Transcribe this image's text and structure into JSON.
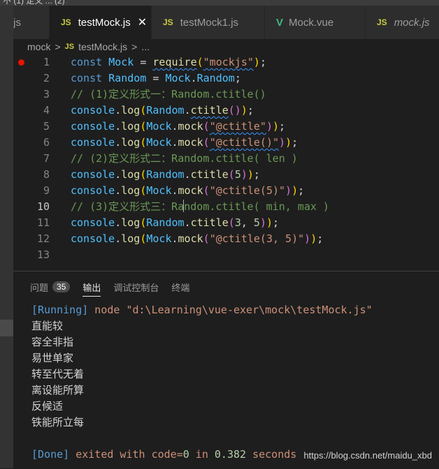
{
  "topstrip": "不 (1)  定义 ...  (2)",
  "tabs": [
    {
      "icon": "JS",
      "label": ".js",
      "active": false
    },
    {
      "icon": "JS",
      "label": "testMock.js",
      "active": true
    },
    {
      "icon": "JS",
      "label": "testMock1.js",
      "active": false
    },
    {
      "icon": "V",
      "label": "Mock.vue",
      "active": false
    },
    {
      "icon": "JS",
      "label": "mock.js",
      "active": false
    }
  ],
  "tab_close": "✕",
  "breadcrumb": {
    "folder": "mock",
    "sep": ">",
    "icon": "JS",
    "file": "testMock.js",
    "rest": "..."
  },
  "lines": [
    {
      "n": "1",
      "t": [
        [
          "kw",
          "const "
        ],
        [
          "cls",
          "Mock"
        ],
        [
          "pl",
          " = "
        ],
        [
          "fn",
          "require"
        ],
        [
          "p1",
          "("
        ],
        [
          "str",
          "\"mockjs\""
        ],
        [
          "p1",
          ")"
        ],
        [
          "pl",
          ";"
        ]
      ]
    },
    {
      "n": "2",
      "t": [
        [
          "kw",
          "const "
        ],
        [
          "cls",
          "Random"
        ],
        [
          "pl",
          " = "
        ],
        [
          "cls",
          "Mock"
        ],
        [
          "pl",
          "."
        ],
        [
          "cls",
          "Random"
        ],
        [
          "pl",
          ";"
        ]
      ]
    },
    {
      "n": "3",
      "t": [
        [
          "cmt",
          "// (1)定义形式一：Random.ctitle()"
        ]
      ]
    },
    {
      "n": "4",
      "t": [
        [
          "cls",
          "console"
        ],
        [
          "pl",
          "."
        ],
        [
          "fn",
          "log"
        ],
        [
          "p1",
          "("
        ],
        [
          "cls",
          "Random"
        ],
        [
          "pl",
          "."
        ],
        [
          "fn",
          "ctitle"
        ],
        [
          "p2",
          "()"
        ],
        [
          "p1",
          ")"
        ],
        [
          "pl",
          ";"
        ]
      ]
    },
    {
      "n": "5",
      "t": [
        [
          "cls",
          "console"
        ],
        [
          "pl",
          "."
        ],
        [
          "fn",
          "log"
        ],
        [
          "p1",
          "("
        ],
        [
          "cls",
          "Mock"
        ],
        [
          "pl",
          "."
        ],
        [
          "fn",
          "mock"
        ],
        [
          "p2",
          "("
        ],
        [
          "str",
          "\"@ctitle\""
        ],
        [
          "p2",
          ")"
        ],
        [
          "p1",
          ")"
        ],
        [
          "pl",
          ";"
        ]
      ]
    },
    {
      "n": "6",
      "t": [
        [
          "cls",
          "console"
        ],
        [
          "pl",
          "."
        ],
        [
          "fn",
          "log"
        ],
        [
          "p1",
          "("
        ],
        [
          "cls",
          "Mock"
        ],
        [
          "pl",
          "."
        ],
        [
          "fn",
          "mock"
        ],
        [
          "p2",
          "("
        ],
        [
          "str",
          "\"@ctitle()\""
        ],
        [
          "p2",
          ")"
        ],
        [
          "p1",
          ")"
        ],
        [
          "pl",
          ";"
        ]
      ]
    },
    {
      "n": "7",
      "t": [
        [
          "cmt",
          "// (2)定义形式二：Random.ctitle( len )"
        ]
      ]
    },
    {
      "n": "8",
      "t": [
        [
          "cls",
          "console"
        ],
        [
          "pl",
          "."
        ],
        [
          "fn",
          "log"
        ],
        [
          "p1",
          "("
        ],
        [
          "cls",
          "Random"
        ],
        [
          "pl",
          "."
        ],
        [
          "fn",
          "ctitle"
        ],
        [
          "p2",
          "("
        ],
        [
          "num",
          "5"
        ],
        [
          "p2",
          ")"
        ],
        [
          "p1",
          ")"
        ],
        [
          "pl",
          ";"
        ]
      ]
    },
    {
      "n": "9",
      "t": [
        [
          "cls",
          "console"
        ],
        [
          "pl",
          "."
        ],
        [
          "fn",
          "log"
        ],
        [
          "p1",
          "("
        ],
        [
          "cls",
          "Mock"
        ],
        [
          "pl",
          "."
        ],
        [
          "fn",
          "mock"
        ],
        [
          "p2",
          "("
        ],
        [
          "str",
          "\"@ctitle(5)\""
        ],
        [
          "p2",
          ")"
        ],
        [
          "p1",
          ")"
        ],
        [
          "pl",
          ";"
        ]
      ]
    },
    {
      "n": "10",
      "t": [
        [
          "cmt",
          "// (3)定义形式三：Random.ctitle( min, max )"
        ]
      ]
    },
    {
      "n": "11",
      "t": [
        [
          "cls",
          "console"
        ],
        [
          "pl",
          "."
        ],
        [
          "fn",
          "log"
        ],
        [
          "p1",
          "("
        ],
        [
          "cls",
          "Random"
        ],
        [
          "pl",
          "."
        ],
        [
          "fn",
          "ctitle"
        ],
        [
          "p2",
          "("
        ],
        [
          "num",
          "3"
        ],
        [
          "pl",
          ", "
        ],
        [
          "num",
          "5"
        ],
        [
          "p2",
          ")"
        ],
        [
          "p1",
          ")"
        ],
        [
          "pl",
          ";"
        ]
      ]
    },
    {
      "n": "12",
      "t": [
        [
          "cls",
          "console"
        ],
        [
          "pl",
          "."
        ],
        [
          "fn",
          "log"
        ],
        [
          "p1",
          "("
        ],
        [
          "cls",
          "Mock"
        ],
        [
          "pl",
          "."
        ],
        [
          "fn",
          "mock"
        ],
        [
          "p2",
          "("
        ],
        [
          "str",
          "\"@ctitle(3, 5)\""
        ],
        [
          "p2",
          ")"
        ],
        [
          "p1",
          ")"
        ],
        [
          "pl",
          ";"
        ]
      ]
    },
    {
      "n": "13",
      "t": []
    }
  ],
  "panel": {
    "tabs": [
      "问题",
      "输出",
      "调试控制台",
      "终端"
    ],
    "problems_count": "35",
    "active_tab": "输出"
  },
  "output": {
    "running_tag": "[Running]",
    "command": " node \"d:\\Learning\\vue-exer\\mock\\testMock.js\"",
    "results": [
      "直能较",
      "容全非指",
      "易世单家",
      "转至代无着",
      "离设能所算",
      "反候适",
      "铁能所立每"
    ],
    "done_tag": "[Done]",
    "exit_pre": " exited with ",
    "exit_code_label": "code=",
    "exit_code": "0",
    "exit_mid": " in ",
    "exit_time": "0.382",
    "exit_post": " seconds"
  },
  "watermark": "https://blog.csdn.net/maidu_xbd",
  "colors": {
    "editor_bg": "#1e1e1e",
    "tab_bg": "#2d2d2d",
    "keyword": "#569cd6",
    "string": "#ce9178",
    "comment": "#6a9955",
    "breakpoint": "#e51400"
  }
}
